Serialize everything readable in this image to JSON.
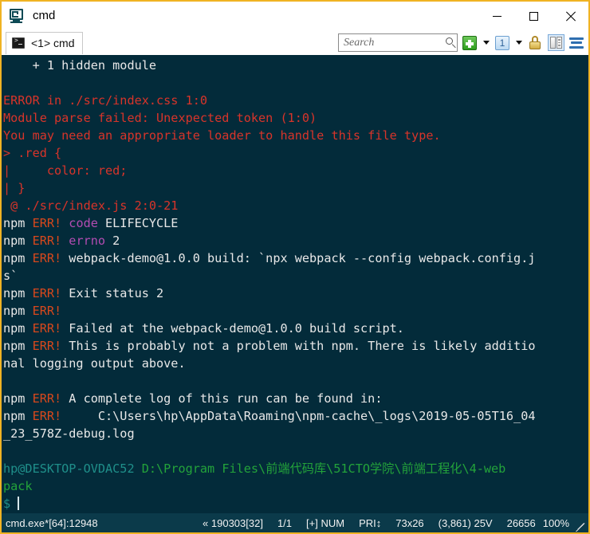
{
  "window": {
    "title": "cmd",
    "app_icon": "conemu-icon",
    "border_color": "#f0b323",
    "minimize_label": "Minimize",
    "maximize_label": "Maximize",
    "close_label": "Close"
  },
  "tabbar": {
    "tabs": [
      {
        "label": "<1> cmd",
        "icon": "console-icon",
        "active": true
      }
    ]
  },
  "toolbar": {
    "search": {
      "placeholder": "Search",
      "value": ""
    },
    "new_console_label": "+",
    "new_console_icon": "green-plus-icon",
    "active_console_label": "1",
    "active_console_icon": "console-number-icon",
    "lock_icon": "padlock-icon",
    "split_icon": "split-pane-icon",
    "menu_icon": "hamburger-menu-icon"
  },
  "terminal": {
    "background": "#032b3a",
    "colors": {
      "white": "#e8e8e8",
      "red": "#d8342a",
      "orange": "#d8481c",
      "magenta": "#b24cb2",
      "green": "#23a33a",
      "cyan": "#1f8f8a"
    },
    "lines": [
      [
        {
          "t": "    + 1 hidden module",
          "c": "c-white"
        }
      ],
      [
        {
          "t": "",
          "c": "c-white"
        }
      ],
      [
        {
          "t": "ERROR in ./src/index.css 1:0",
          "c": "c-red"
        }
      ],
      [
        {
          "t": "Module parse failed: Unexpected token (1:0)",
          "c": "c-red"
        }
      ],
      [
        {
          "t": "You may need an appropriate loader to handle this file type.",
          "c": "c-red"
        }
      ],
      [
        {
          "t": "> .red {",
          "c": "c-red"
        }
      ],
      [
        {
          "t": "|     color: red;",
          "c": "c-red"
        }
      ],
      [
        {
          "t": "| }",
          "c": "c-red"
        }
      ],
      [
        {
          "t": " @ ./src/index.js 2:0-21",
          "c": "c-red"
        }
      ],
      [
        {
          "t": "npm ",
          "c": "c-white"
        },
        {
          "t": "ERR! ",
          "c": "c-orange"
        },
        {
          "t": "code ",
          "c": "c-magenta"
        },
        {
          "t": "ELIFECYCLE",
          "c": "c-white"
        }
      ],
      [
        {
          "t": "npm ",
          "c": "c-white"
        },
        {
          "t": "ERR! ",
          "c": "c-orange"
        },
        {
          "t": "errno ",
          "c": "c-magenta"
        },
        {
          "t": "2",
          "c": "c-white"
        }
      ],
      [
        {
          "t": "npm ",
          "c": "c-white"
        },
        {
          "t": "ERR! ",
          "c": "c-orange"
        },
        {
          "t": "webpack-demo@1.0.0 build: `npx webpack --config webpack.config.j",
          "c": "c-white"
        }
      ],
      [
        {
          "t": "s`",
          "c": "c-white"
        }
      ],
      [
        {
          "t": "npm ",
          "c": "c-white"
        },
        {
          "t": "ERR! ",
          "c": "c-orange"
        },
        {
          "t": "Exit status 2",
          "c": "c-white"
        }
      ],
      [
        {
          "t": "npm ",
          "c": "c-white"
        },
        {
          "t": "ERR!",
          "c": "c-orange"
        }
      ],
      [
        {
          "t": "npm ",
          "c": "c-white"
        },
        {
          "t": "ERR! ",
          "c": "c-orange"
        },
        {
          "t": "Failed at the webpack-demo@1.0.0 build script.",
          "c": "c-white"
        }
      ],
      [
        {
          "t": "npm ",
          "c": "c-white"
        },
        {
          "t": "ERR! ",
          "c": "c-orange"
        },
        {
          "t": "This is probably not a problem with npm. There is likely additio",
          "c": "c-white"
        }
      ],
      [
        {
          "t": "nal logging output above.",
          "c": "c-white"
        }
      ],
      [
        {
          "t": "",
          "c": "c-white"
        }
      ],
      [
        {
          "t": "npm ",
          "c": "c-white"
        },
        {
          "t": "ERR! ",
          "c": "c-orange"
        },
        {
          "t": "A complete log of this run can be found in:",
          "c": "c-white"
        }
      ],
      [
        {
          "t": "npm ",
          "c": "c-white"
        },
        {
          "t": "ERR! ",
          "c": "c-orange"
        },
        {
          "t": "    C:\\Users\\hp\\AppData\\Roaming\\npm-cache\\_logs\\2019-05-05T16_04",
          "c": "c-white"
        }
      ],
      [
        {
          "t": "_23_578Z-debug.log",
          "c": "c-white"
        }
      ],
      [
        {
          "t": "",
          "c": "c-white"
        }
      ],
      [
        {
          "t": "hp@DESKTOP-OVDAC52",
          "c": "c-cyan"
        },
        {
          "t": " ",
          "c": "c-white"
        },
        {
          "t": "D:\\Program Files\\前端代码库\\51CTO学院\\前端工程化\\4-web",
          "c": "c-green"
        }
      ],
      [
        {
          "t": "pack",
          "c": "c-green"
        }
      ],
      [
        {
          "t": "$ ",
          "c": "c-cyan"
        },
        {
          "t": "__CURSOR__",
          "c": "c-white"
        }
      ]
    ]
  },
  "statusbar": {
    "process": "cmd.exe*[64]:12948",
    "build": "« 190303[32]",
    "tabs_count": "1/1",
    "flags": "[+] NUM",
    "priority": "PRI↕",
    "size": "73x26",
    "cursor_pos": "(3,861) 25V",
    "buffer": "26656",
    "zoom": "100%"
  }
}
